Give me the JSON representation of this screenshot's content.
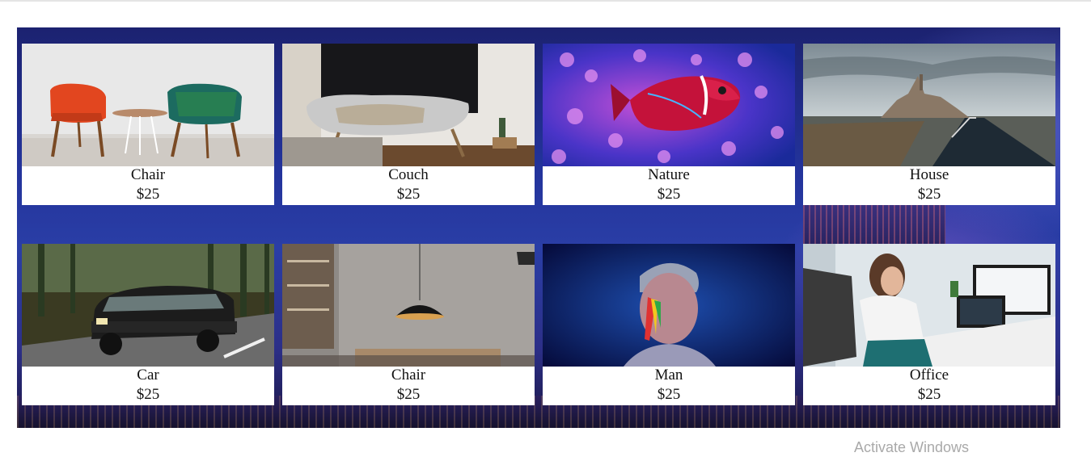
{
  "products": [
    {
      "name": "Chair",
      "price": "$25",
      "image": "chair-photo"
    },
    {
      "name": "Couch",
      "price": "$25",
      "image": "couch-photo"
    },
    {
      "name": "Nature",
      "price": "$25",
      "image": "fish-coral-photo"
    },
    {
      "name": "House",
      "price": "$25",
      "image": "castle-island-photo"
    },
    {
      "name": "Car",
      "price": "$25",
      "image": "suv-road-photo"
    },
    {
      "name": "Chair",
      "price": "$25",
      "image": "interior-lamp-photo"
    },
    {
      "name": "Man",
      "price": "$25",
      "image": "face-paint-photo"
    },
    {
      "name": "Office",
      "price": "$25",
      "image": "office-woman-photo"
    }
  ],
  "os_watermark": "Activate Windows",
  "colors": {
    "background_deep": "#1c2270",
    "background_mid": "#2a3ea6",
    "card": "#ffffff",
    "text": "#111111"
  }
}
